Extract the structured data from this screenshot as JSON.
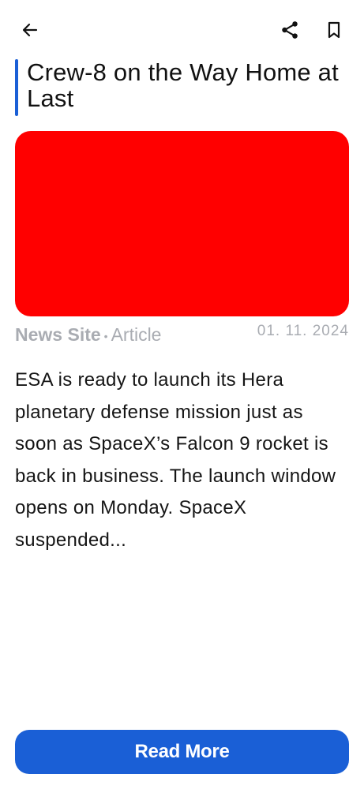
{
  "toolbar": {
    "back_icon": "arrow-left-icon",
    "share_icon": "share-icon",
    "bookmark_icon": "bookmark-icon"
  },
  "article": {
    "title": "Crew-8 on the Way Home at Last",
    "source": "News Site",
    "separator": "•",
    "kind": "Article",
    "date": "01. 11. 2024",
    "summary": "ESA is ready to launch its Hera planetary defense mission just as soon as SpaceX’s Falcon 9 rocket is back in business. The launch window opens on Monday. SpaceX suspended..."
  },
  "actions": {
    "read_more_label": "Read More"
  },
  "colors": {
    "accent": "#1a5fd6",
    "image_placeholder": "#ff0000",
    "muted_text": "#a9acb2"
  }
}
